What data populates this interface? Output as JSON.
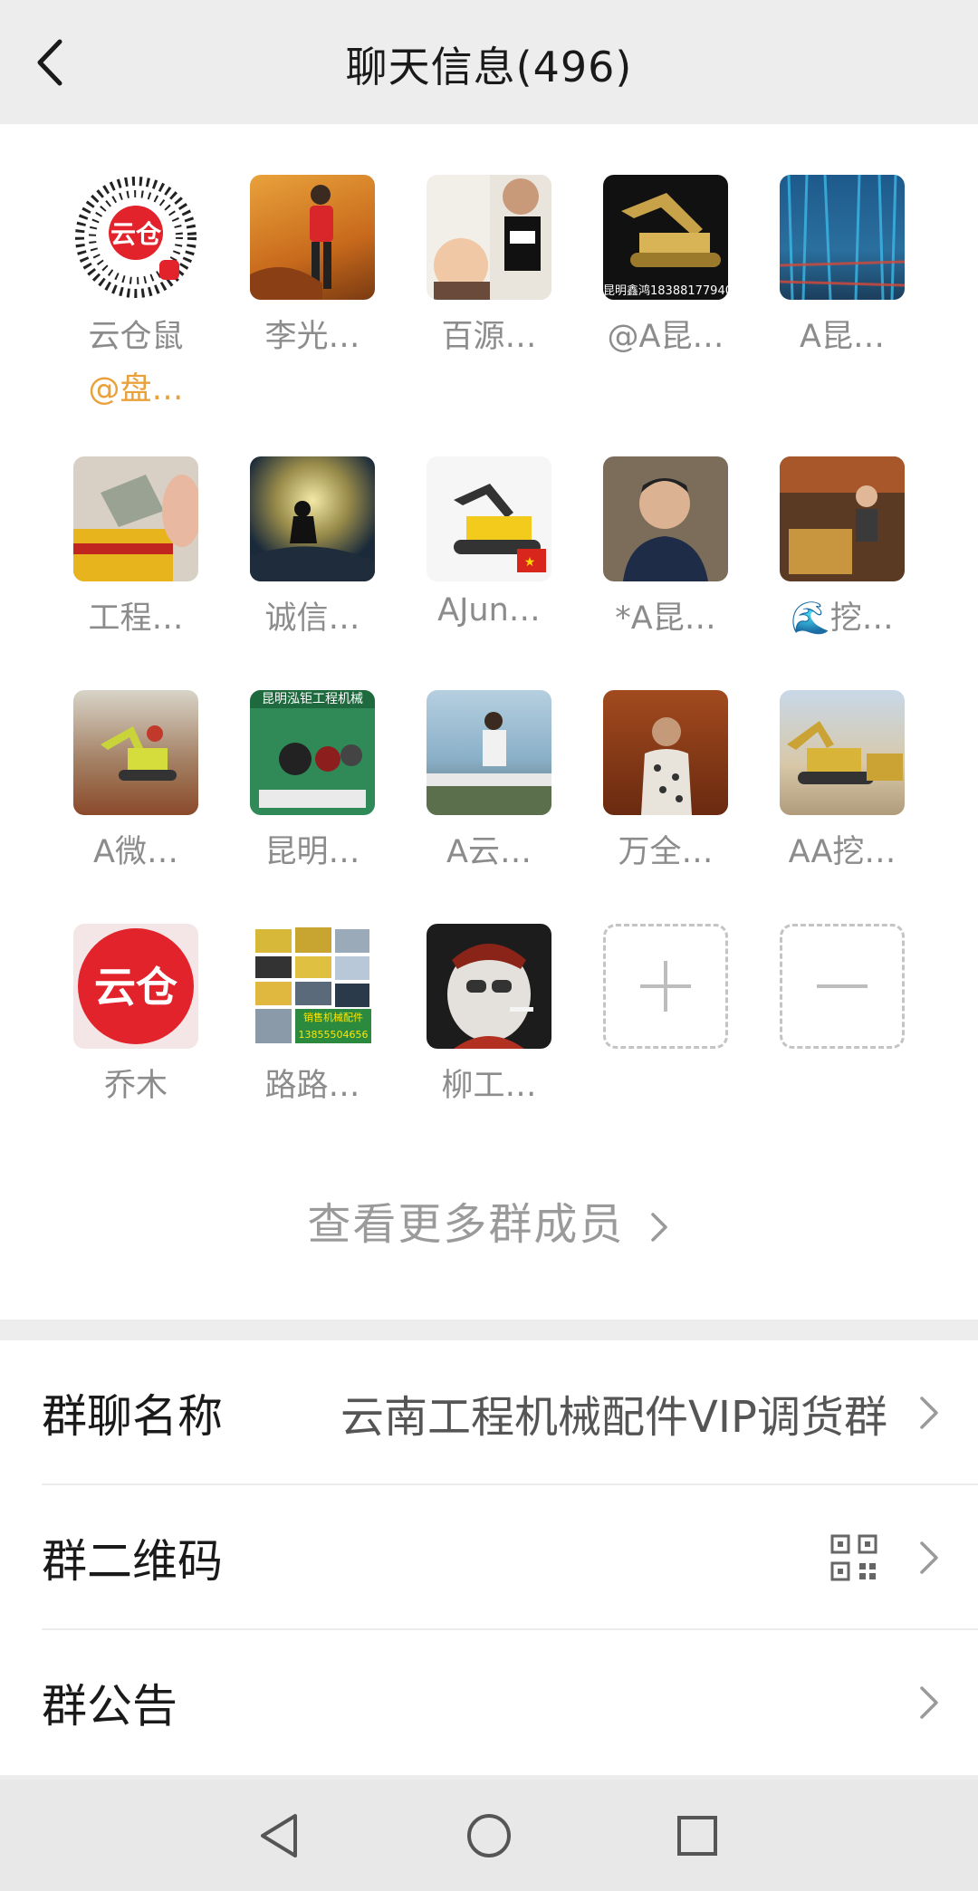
{
  "header": {
    "title": "聊天信息(496)"
  },
  "members": [
    {
      "name": "云仓鼠",
      "sub": "@盘…"
    },
    {
      "name": "李光…"
    },
    {
      "name": "百源…"
    },
    {
      "name": "@A昆…",
      "avatar_text": "昆明鑫鸿18388177940"
    },
    {
      "name": "A昆…"
    },
    {
      "name": "工程…"
    },
    {
      "name": "诚信…"
    },
    {
      "name": "AJun…"
    },
    {
      "name": "*A昆…"
    },
    {
      "name": "🌊挖…"
    },
    {
      "name": "A微…"
    },
    {
      "name": "昆明…",
      "avatar_text": "昆明泓钜工程机械"
    },
    {
      "name": "A云…"
    },
    {
      "name": "万全…"
    },
    {
      "name": "AA挖…"
    },
    {
      "name": "乔木",
      "avatar_text": "云仓"
    },
    {
      "name": "路路…",
      "avatar_text": "销售机械配件 13855504656"
    },
    {
      "name": "柳工…"
    }
  ],
  "actions": {
    "add": "+",
    "remove": "−"
  },
  "more_members": "查看更多群成员",
  "settings": {
    "group_name_label": "群聊名称",
    "group_name_value": "云南工程机械配件VIP调货群",
    "qr_label": "群二维码",
    "notice_label": "群公告"
  }
}
